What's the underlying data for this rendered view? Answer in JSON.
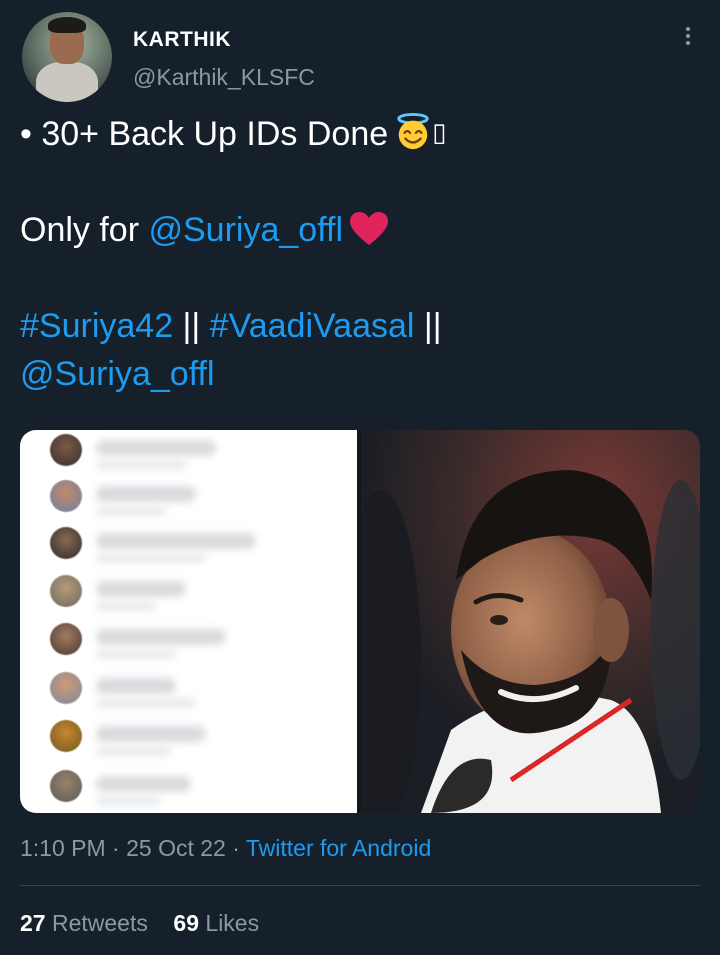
{
  "author": {
    "display_name": "KARTHIK",
    "handle": "@Karthik_KLSFC"
  },
  "tweet": {
    "line1_text": "• 30+ Back Up IDs Done",
    "line1_trailing_glyph": "▯",
    "line2_prefix": "Only for ",
    "line2_mention": "@Suriya_offl",
    "line3_hashtag1": "#Suriya42",
    "line3_sep1": " || ",
    "line3_hashtag2": "#VaadiVaasal",
    "line3_sep2": " ||",
    "line4_mention": "@Suriya_offl",
    "emoji": [
      "smiling-face-with-halo",
      "red-heart"
    ]
  },
  "meta": {
    "time": "1:10 PM",
    "sep1": " · ",
    "date": "25 Oct 22",
    "sep2": " · ",
    "source": "Twitter for Android"
  },
  "stats": {
    "retweets_count": "27",
    "retweets_label": "Retweets",
    "likes_count": "69",
    "likes_label": "Likes"
  },
  "colors": {
    "background": "#15202b",
    "link": "#1d9bf0",
    "secondary_text": "#8b98a5",
    "divider": "#38444d"
  },
  "icons": {
    "menu": "more-vertical-icon"
  }
}
